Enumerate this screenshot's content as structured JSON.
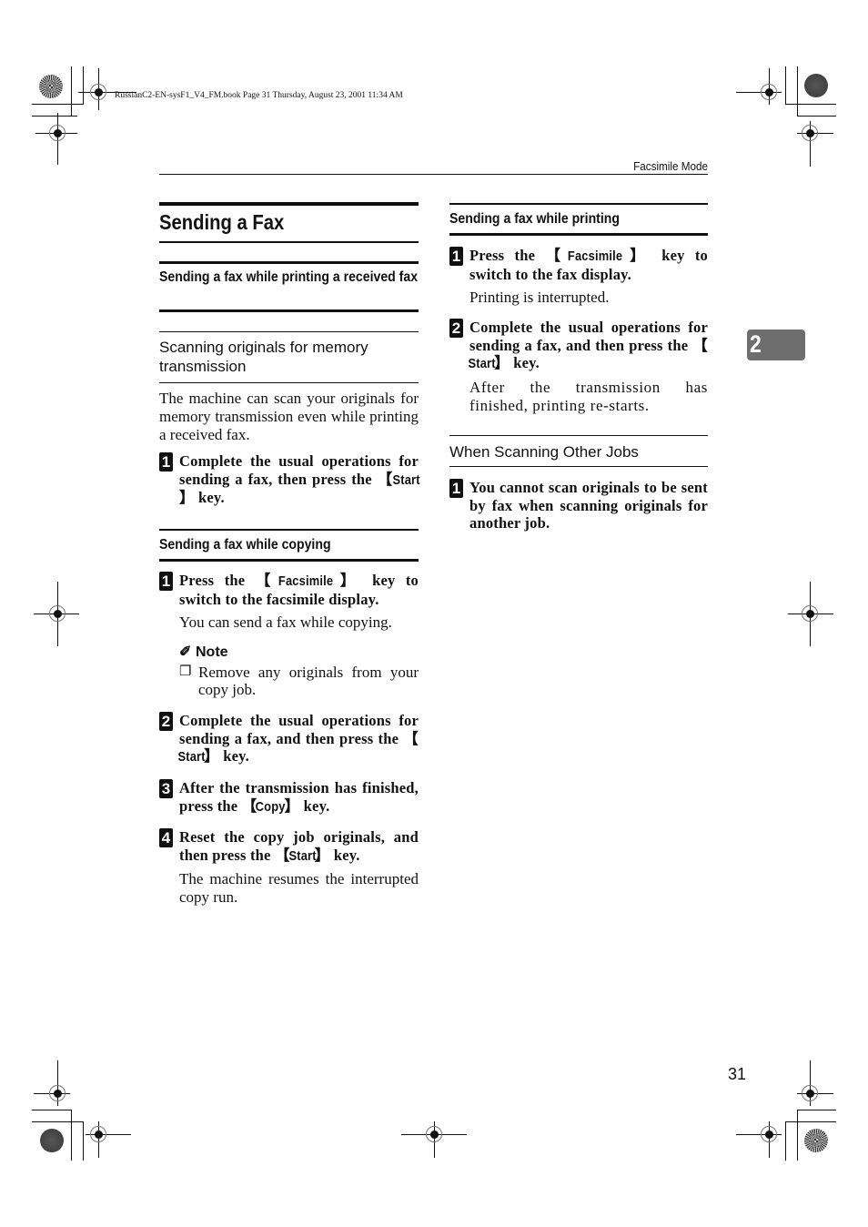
{
  "book_info": "RussianC2-EN-sysF1_V4_FM.book  Page 31  Thursday, August 23, 2001  11:34 AM",
  "running_head": "Facsimile Mode",
  "chapter_tab": "2",
  "page_number": "31",
  "left_column": {
    "title": "Sending a Fax",
    "section1": {
      "heading": "Sending a fax while printing a received fax",
      "subheading": "Scanning originals for memory transmission",
      "intro": "The machine can scan your originals for memory transmission even while printing a received fax.",
      "steps": [
        {
          "num": "1",
          "text_before": "Complete the usual operations for sending a fax, then press the ",
          "key": "Start",
          "text_after": " key."
        }
      ]
    },
    "section2": {
      "heading": "Sending a fax while copying",
      "steps": [
        {
          "num": "1",
          "text_before": "Press the ",
          "key": "Facsimile",
          "text_after": " key to switch to the facsimile display.",
          "result": "You can send a fax while copying."
        },
        {
          "num": "2",
          "text_before": "Complete the usual operations for sending a fax, and then press the ",
          "key": "Start",
          "text_after": " key."
        },
        {
          "num": "3",
          "text_before": "After the transmission has finished, press the ",
          "key": "Copy",
          "text_after": " key."
        },
        {
          "num": "4",
          "text_before": "Reset the copy job originals, and then press the ",
          "key": "Start",
          "text_after": " key.",
          "result": "The machine resumes the interrupted copy run."
        }
      ],
      "note": {
        "icon": "pencil-icon",
        "heading": "Note",
        "items": [
          "Remove any originals from your copy job."
        ]
      }
    }
  },
  "right_column": {
    "section1": {
      "heading": "Sending a fax while printing",
      "steps": [
        {
          "num": "1",
          "text_before": "Press the ",
          "key": "Facsimile",
          "text_after": " key to switch to the fax display.",
          "result": "Printing is interrupted."
        },
        {
          "num": "2",
          "text_before": "Complete the usual operations for sending a fax, and then press the ",
          "key": "Start",
          "text_after": " key.",
          "result": "After the transmission has finished, printing re-starts."
        }
      ]
    },
    "section2": {
      "heading": "When Scanning Other Jobs",
      "steps": [
        {
          "num": "1",
          "text": "You cannot scan originals to be sent by fax when scanning originals for another job."
        }
      ]
    }
  }
}
